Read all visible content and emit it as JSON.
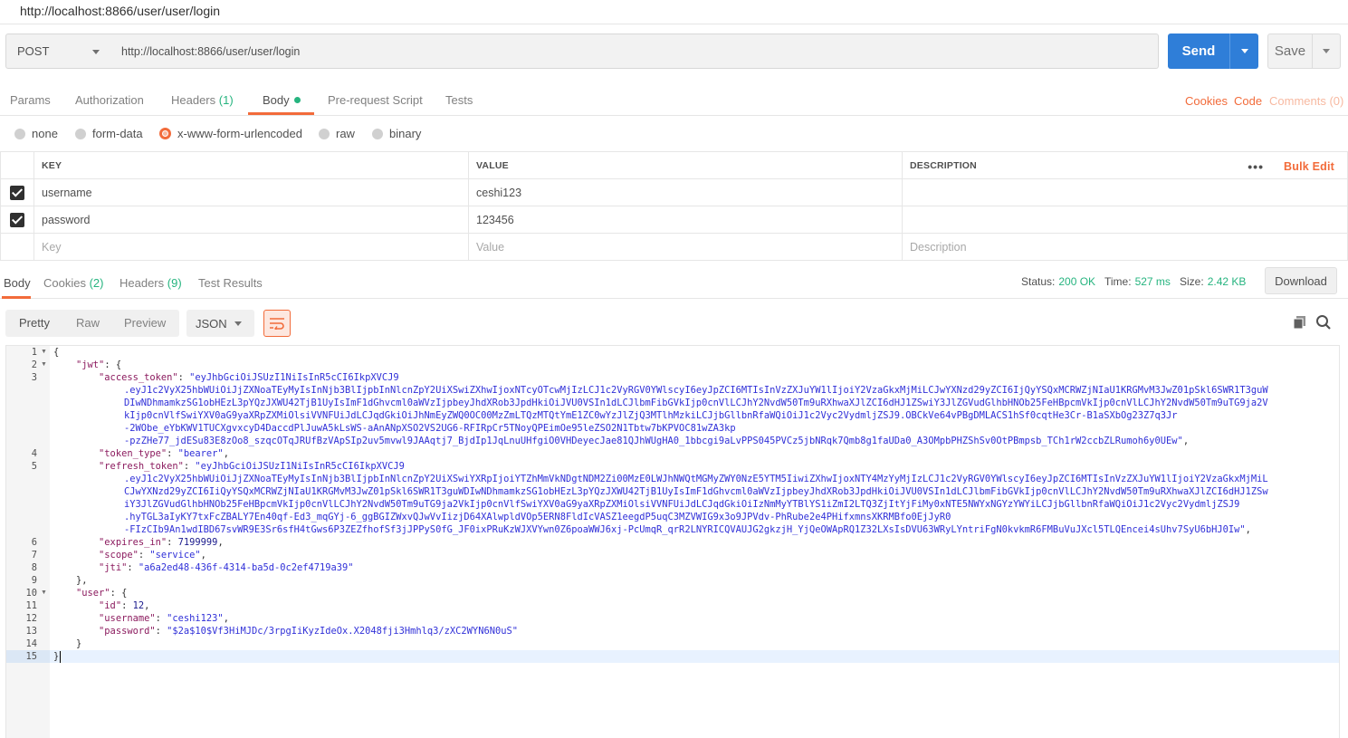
{
  "request": {
    "title": "http://localhost:8866/user/user/login",
    "method": "POST",
    "url": "http://localhost:8866/user/user/login",
    "send_label": "Send",
    "save_label": "Save"
  },
  "request_tabs": {
    "params": "Params",
    "authorization": "Authorization",
    "headers": "Headers",
    "headers_count": "(1)",
    "body": "Body",
    "prerequest": "Pre-request Script",
    "tests": "Tests",
    "cookies": "Cookies",
    "code": "Code",
    "comments": "Comments (0)"
  },
  "body_types": {
    "none": "none",
    "form_data": "form-data",
    "urlencoded": "x-www-form-urlencoded",
    "raw": "raw",
    "binary": "binary",
    "selected": "x-www-form-urlencoded"
  },
  "kv_table": {
    "headers": {
      "key": "KEY",
      "value": "VALUE",
      "description": "DESCRIPTION"
    },
    "bulk_edit": "Bulk Edit",
    "rows": [
      {
        "key": "username",
        "value": "ceshi123",
        "description": "",
        "checked": true
      },
      {
        "key": "password",
        "value": "123456",
        "description": "",
        "checked": true
      }
    ],
    "placeholders": {
      "key": "Key",
      "value": "Value",
      "description": "Description"
    }
  },
  "response_tabs": {
    "body": "Body",
    "cookies": "Cookies",
    "cookies_count": "(2)",
    "headers": "Headers",
    "headers_count": "(9)",
    "test_results": "Test Results"
  },
  "response_meta": {
    "status_label": "Status:",
    "status_value": "200 OK",
    "time_label": "Time:",
    "time_value": "527 ms",
    "size_label": "Size:",
    "size_value": "2.42 KB",
    "download": "Download"
  },
  "view_toolbar": {
    "pretty": "Pretty",
    "raw": "Raw",
    "preview": "Preview",
    "format": "JSON"
  },
  "response_lines": [
    "1",
    "2",
    "3",
    "",
    "",
    "",
    "",
    "",
    "4",
    "5",
    "",
    "",
    "",
    "",
    "",
    "6",
    "7",
    "8",
    "9",
    "10",
    "11",
    "12",
    "13",
    "14",
    "15"
  ],
  "response_body": {
    "l1": "{",
    "jwt_key": "\"jwt\"",
    "access_token_key": "\"access_token\"",
    "access_token_1": "\"eyJhbGciOiJSUzI1NiIsInR5cCI6IkpXVCJ9",
    "access_token_2": ".eyJ1c2VyX25hbWUiOiJjZXNoaTEyMyIsInNjb3BlIjpbInNlcnZpY2UiXSwiZXhwIjoxNTcyOTcwMjIzLCJ1c2VyRGV0YWlscyI6eyJpZCI6MTIsInVzZXJuYW1lIjoiY2VzaGkxMjMiLCJwYXNzd29yZCI6IjQyYSQxMCRWZjNIaU1KRGMvM3JwZ01pSkl6SWR1T3guW",
    "access_token_3": "DIwNDhmamkzSG1obHEzL3pYQzJXWU42TjB1UyIsImF1dGhvcml0aWVzIjpbeyJhdXRob3JpdHkiOiJVU0VSIn1dLCJlbmFibGVkIjp0cnVlLCJhY2NvdW50Tm9uRXhwaXJlZCI6dHJ1ZSwiY3JlZGVudGlhbHNOb25FeHBpcmVkIjp0cnVlLCJhY2NvdW50Tm9uTG9ja2V",
    "access_token_4": "kIjp0cnVlfSwiYXV0aG9yaXRpZXMiOlsiVVNFUiJdLCJqdGkiOiJhNmEyZWQ0OC00MzZmLTQzMTQtYmE1ZC0wYzJlZjQ3MTlhMzkiLCJjbGllbnRfaWQiOiJ1c2Vyc2VydmljZSJ9.OBCkVe64vPBgDMLACS1hSf0cqtHe3Cr-B1aSXbOg23Z7q3Jr",
    "access_token_5": "-2WObe_eYbKWV1TUCXgvxcyD4DaccdPlJuwA5kLsWS-aAnANpXSO2VS2UG6-RFIRpCr5TNoyQPEimOe95leZSO2N1Tbtw7bKPVOC81wZA3kp",
    "access_token_6": "-pzZHe77_jdESu83E8zOo8_szqcOTqJRUfBzVApSIp2uv5mvwl9JAAqtj7_BjdIp1JqLnuUHfgiO0VHDeyecJae81QJhWUgHA0_1bbcgi9aLvPPS045PVCz5jbNRqk7Qmb8g1faUDa0_A3OMpbPHZShSv0OtPBmpsb_TCh1rW2ccbZLRumoh6y0UEw\"",
    "token_type_key": "\"token_type\"",
    "token_type_val": "\"bearer\"",
    "refresh_token_key": "\"refresh_token\"",
    "refresh_token_1": "\"eyJhbGciOiJSUzI1NiIsInR5cCI6IkpXVCJ9",
    "refresh_token_2": ".eyJ1c2VyX25hbWUiOiJjZXNoaTEyMyIsInNjb3BlIjpbInNlcnZpY2UiXSwiYXRpIjoiYTZhMmVkNDgtNDM2Zi00MzE0LWJhNWQtMGMyZWY0NzE5YTM5IiwiZXhwIjoxNTY4MzYyMjIzLCJ1c2VyRGV0YWlscyI6eyJpZCI6MTIsInVzZXJuYW1lIjoiY2VzaGkxMjMiL",
    "refresh_token_3": "CJwYXNzd29yZCI6IiQyYSQxMCRWZjNIaU1KRGMvM3JwZ01pSkl6SWR1T3guWDIwNDhmamkzSG1obHEzL3pYQzJXWU42TjB1UyIsImF1dGhvcml0aWVzIjpbeyJhdXRob3JpdHkiOiJVU0VSIn1dLCJlbmFibGVkIjp0cnVlLCJhY2NvdW50Tm9uRXhwaXJlZCI6dHJ1ZSw",
    "refresh_token_4": "iY3JlZGVudGlhbHNOb25FeHBpcmVkIjp0cnVlLCJhY2NvdW50Tm9uTG9ja2VkIjp0cnVlfSwiYXV0aG9yaXRpZXMiOlsiVVNFUiJdLCJqdGkiOiIzNmMyYTBlYS1iZmI2LTQ3ZjItYjFiMy0xNTE5NWYxNGYzYWYiLCJjbGllbnRfaWQiOiJ1c2Vyc2VydmljZSJ9",
    "refresh_token_5": ".hyTGL3aIyKY7txFcZBALY7En40qf-Ed3_mqGYj-6_ggBGIZWxvQJwVvIizjD64XAlwpldVOp5ERN8FldIcVASZ1eegdP5uqC3MZVWIG9x3o9JPVdv-PhRube2e4PHifxmnsXKRMBfo0EjJyR0",
    "refresh_token_6": "-FIzCIb9An1wdIBD67svWR9E3Sr6sfH4tGws6P3ZEZfhofSf3jJPPyS0fG_JF0ixPRuKzWJXVYwn0Z6poaWWJ6xj-PcUmqR_qrR2LNYRICQVAUJG2gkzjH_YjQeOWApRQ1Z32LXsIsDVU63WRyLYntriFgN0kvkmR6FMBuVuJXcl5TLQEncei4sUhv7SyU6bHJ0Iw\"",
    "expires_in_key": "\"expires_in\"",
    "expires_in_val": "7199999",
    "scope_key": "\"scope\"",
    "scope_val": "\"service\"",
    "jti_key": "\"jti\"",
    "jti_val": "\"a6a2ed48-436f-4314-ba5d-0c2ef4719a39\"",
    "user_key": "\"user\"",
    "id_key": "\"id\"",
    "id_val": "12",
    "username_key": "\"username\"",
    "username_val": "\"ceshi123\"",
    "password_key": "\"password\"",
    "password_val": "\"$2a$10$Vf3HiMJDc/3rpgIiKyzIdeOx.X2048fji3Hmhlq3/zXC2WYN6N0uS\"",
    "close": "}"
  },
  "icons": {
    "copy": "copy-icon",
    "search": "search-icon",
    "wrap": "wrap-lines-icon"
  },
  "colors": {
    "accent": "#f26b3a",
    "send": "#2f7ed8",
    "status_ok": "#26b47f"
  }
}
